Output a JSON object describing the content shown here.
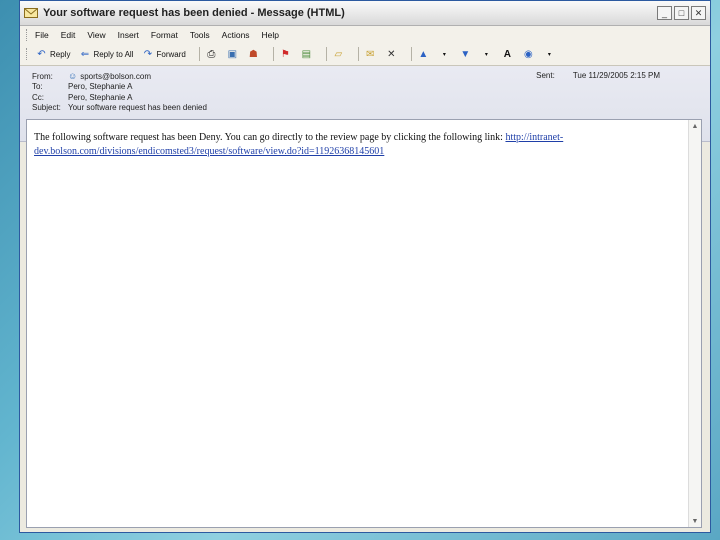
{
  "window": {
    "title": "Your software request has been denied - Message (HTML)",
    "buttons": {
      "minimize": "_",
      "maximize": "□",
      "close": "✕"
    }
  },
  "menu": [
    "File",
    "Edit",
    "View",
    "Insert",
    "Format",
    "Tools",
    "Actions",
    "Help"
  ],
  "toolbar": {
    "reply": "Reply",
    "reply_all": "Reply to All",
    "forward": "Forward"
  },
  "header": {
    "from_label": "From:",
    "from_value": "sports@bolson.com",
    "to_label": "To:",
    "to_value": "Pero, Stephanie A",
    "cc_label": "Cc:",
    "cc_value": "Pero, Stephanie A",
    "subject_label": "Subject:",
    "subject_value": "Your software request has been denied",
    "sent_label": "Sent:",
    "sent_value": "Tue 11/29/2005 2:15 PM"
  },
  "message": {
    "body_text": "The following software request has been Deny. You can go directly to the review page by clicking the following link: ",
    "link_text": "http://intranet-dev.bolson.com/divisions/endicomsted3/request/software/view.do?id=11926368145601"
  }
}
